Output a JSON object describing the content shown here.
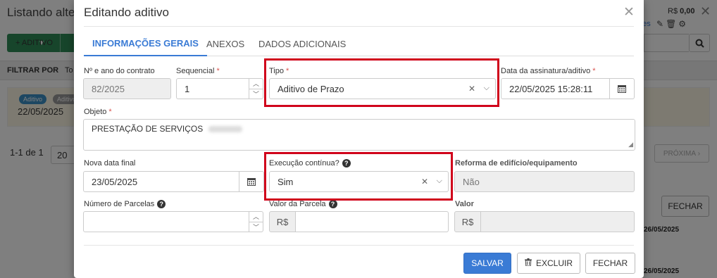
{
  "background": {
    "page_title": "Listando alte",
    "add_button": "+ ADITIVO",
    "filter_label": "FILTRAR POR",
    "filter_value": "To",
    "row": {
      "badge_1": "Aditivo",
      "badge_2": "Aditivo",
      "date": "22/05/2025",
      "amount_prefix": "R$",
      "amount": "0,00",
      "link_fragment": "nes"
    },
    "pagination": {
      "range": "1-1 de 1",
      "page_size": "20",
      "next": "PRÓXIMA"
    },
    "close_button": "FECHAR",
    "date_a": "26/05/2025",
    "date_b": "26/05/2025"
  },
  "modal": {
    "title": "Editando aditivo",
    "tabs": [
      {
        "label": "INFORMAÇÕES GERAIS",
        "active": true
      },
      {
        "label": "ANEXOS",
        "active": false
      },
      {
        "label": "DADOS ADICIONAIS",
        "active": false
      }
    ],
    "fields": {
      "contrato": {
        "label": "Nº e ano do contrato",
        "value": "82/2025"
      },
      "sequencial": {
        "label": "Sequencial",
        "value": "1"
      },
      "tipo": {
        "label": "Tipo",
        "value": "Aditivo de Prazo"
      },
      "data_assinatura": {
        "label": "Data da assinatura/aditivo",
        "value": "22/05/2025 15:28:11"
      },
      "objeto": {
        "label": "Objeto",
        "value": "PRESTAÇÃO DE SERVIÇOS"
      },
      "nova_data_final": {
        "label": "Nova data final",
        "value": "23/05/2025"
      },
      "execucao_continua": {
        "label": "Execução contínua?",
        "value": "Sim"
      },
      "reforma": {
        "label": "Reforma de edifício/equipamento",
        "value": "Não"
      },
      "numero_parcelas": {
        "label": "Número de Parcelas",
        "value": ""
      },
      "valor_parcela": {
        "label": "Valor da Parcela",
        "prefix": "R$",
        "value": ""
      },
      "valor": {
        "label": "Valor",
        "prefix": "R$",
        "value": ""
      }
    },
    "buttons": {
      "save": "SALVAR",
      "delete": "EXCLUIR",
      "close": "FECHAR"
    }
  },
  "colors": {
    "primary": "#3a7bd5",
    "required": "#d9534f",
    "highlight": "#d0021b",
    "add_button": "#2e8b57"
  }
}
